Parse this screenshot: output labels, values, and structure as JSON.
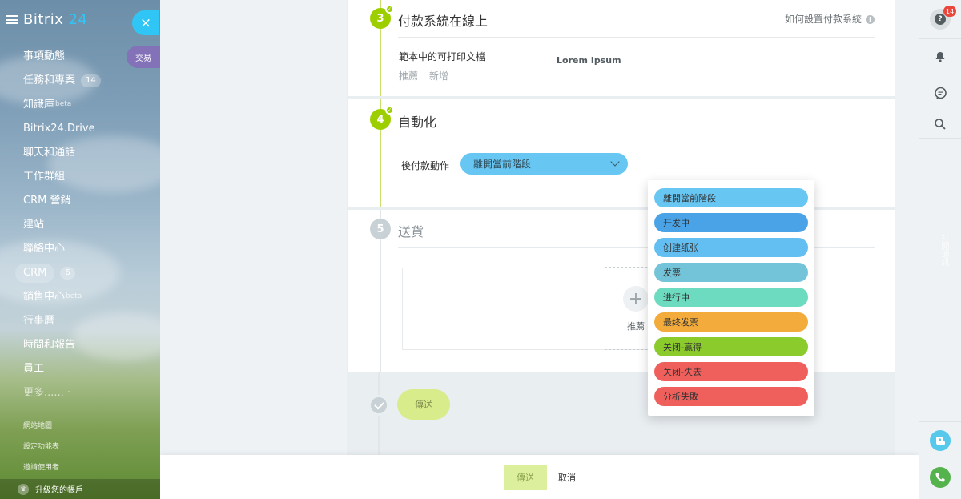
{
  "sidebar": {
    "logo_text": "Bitrix",
    "logo_num": "24",
    "close_icon": "×",
    "deal_tab": "交易",
    "items": [
      {
        "label": "事項動態"
      },
      {
        "label": "任務和專案",
        "badge": "14"
      },
      {
        "label": "知識庫",
        "sup": "beta"
      },
      {
        "label": "Bitrix24.Drive"
      },
      {
        "label": "聊天和通話"
      },
      {
        "label": "工作群組"
      },
      {
        "label": "CRM 營銷"
      },
      {
        "label": "建站"
      },
      {
        "label": "聯絡中心"
      },
      {
        "label": "CRM",
        "badge": "6"
      },
      {
        "label": "銷售中心",
        "sup": "beta"
      },
      {
        "label": "行事曆"
      },
      {
        "label": "時間和報告"
      },
      {
        "label": "員工"
      },
      {
        "label": "更多...... ·"
      }
    ],
    "footer": [
      "網站地圖",
      "設定功能表",
      "邀請使用者"
    ],
    "upgrade": "升級您的帳戶"
  },
  "steps": {
    "step3": {
      "num": "3",
      "title": "付款系統在線上",
      "help": "如何設置付款系統",
      "print_label": "範本中的可打印文檔",
      "links": [
        "推薦",
        "新增"
      ],
      "lorem": "Lorem Ipsum"
    },
    "step4": {
      "num": "4",
      "title": "自動化",
      "label": "後付款動作",
      "selected": "離開當前階段"
    },
    "step5": {
      "num": "5",
      "title": "送貨",
      "recommend": "推薦"
    },
    "send": "傳送"
  },
  "dropdown": {
    "options": [
      {
        "label": "離開當前階段",
        "color": "#68c6f3"
      },
      {
        "label": "开发中",
        "color": "#4aa3e6"
      },
      {
        "label": "创建纸张",
        "color": "#63bff2"
      },
      {
        "label": "发票",
        "color": "#74c4d9"
      },
      {
        "label": "进行中",
        "color": "#6cdbc0"
      },
      {
        "label": "最终发票",
        "color": "#f3ac3c"
      },
      {
        "label": "关闭-赢得",
        "color": "#8bcb2c"
      },
      {
        "label": "关闭-失去",
        "color": "#ef5f5b"
      },
      {
        "label": "分析失敗",
        "color": "#ef5f5b"
      }
    ]
  },
  "footer_bar": {
    "send": "傳送",
    "cancel": "取消"
  },
  "rightbar": {
    "help_badge": "14",
    "vertical_text": "打開通訊"
  }
}
